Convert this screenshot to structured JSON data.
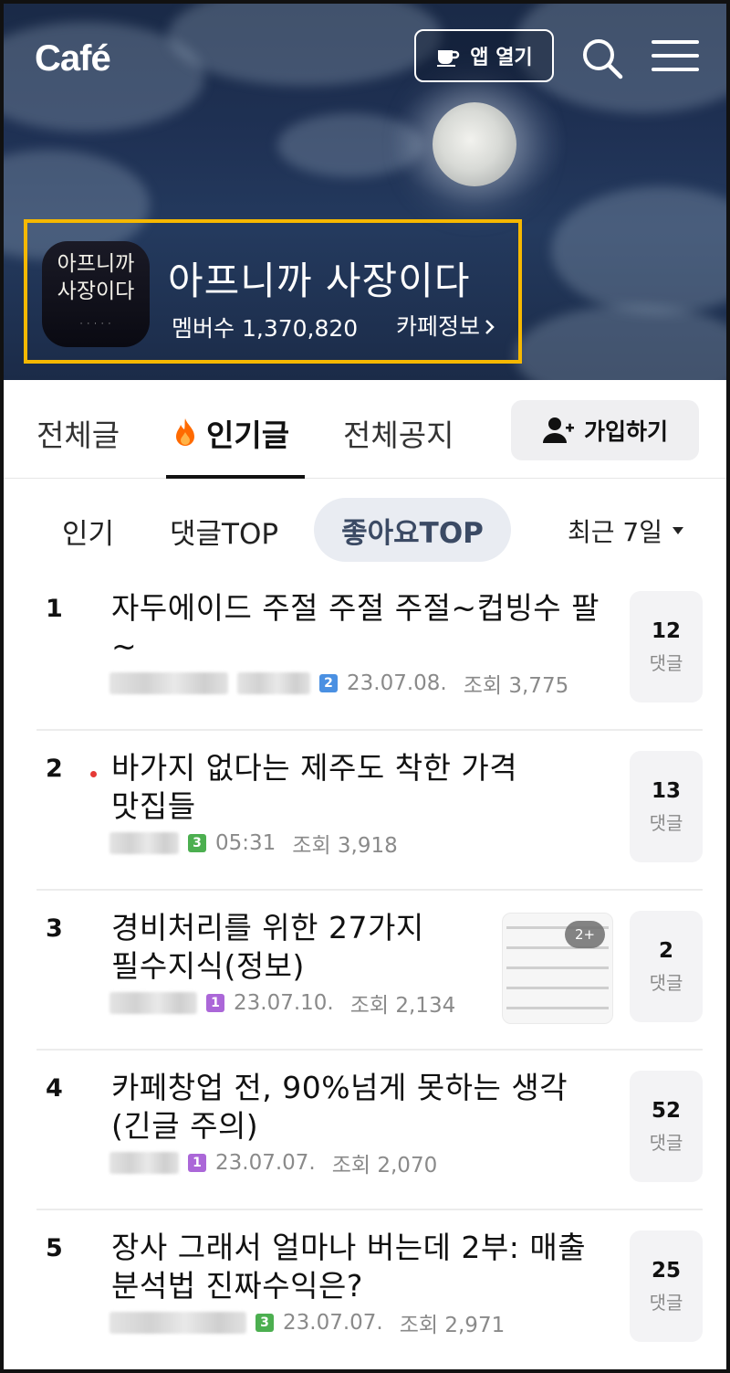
{
  "header": {
    "logo": "Café",
    "open_app_label": "앱 열기"
  },
  "cafe": {
    "name": "아프니까 사장이다",
    "members_label": "멤버수",
    "members_count": "1,370,820",
    "info_link": "카페정보",
    "thumb_line1": "아프니까",
    "thumb_line2": "사장이다"
  },
  "tabs": {
    "all": "전체글",
    "popular": "인기글",
    "notice": "전체공지",
    "join": "가입하기"
  },
  "filters": {
    "popular": "인기",
    "comment_top": "댓글TOP",
    "like_top": "좋아요TOP",
    "period": "최근 7일"
  },
  "posts": [
    {
      "rank": "1",
      "title": "자두에이드 주절 주절 주절~컵빙수 팔~",
      "level": "2",
      "level_color": "#4a90e2",
      "date": "23.07.08.",
      "views": "조회 3,775",
      "comments": "12",
      "comments_label": "댓글"
    },
    {
      "rank": "2",
      "title": "바가지 없다는 제주도 착한 가격 맛집들",
      "level": "3",
      "level_color": "#4caf50",
      "date": "05:31",
      "views": "조회 3,918",
      "comments": "13",
      "comments_label": "댓글"
    },
    {
      "rank": "3",
      "title": "경비처리를 위한 27가지 필수지식(정보)",
      "level": "1",
      "level_color": "#ab67d8",
      "date": "23.07.10.",
      "views": "조회 2,134",
      "comments": "2",
      "comments_label": "댓글",
      "thumb_badge": "2+"
    },
    {
      "rank": "4",
      "title": "카페창업 전, 90%넘게 못하는 생각(긴글 주의)",
      "level": "1",
      "level_color": "#ab67d8",
      "date": "23.07.07.",
      "views": "조회 2,070",
      "comments": "52",
      "comments_label": "댓글"
    },
    {
      "rank": "5",
      "title": "장사 그래서 얼마나 버는데 2부: 매출 분석법 진짜수익은?",
      "level": "3",
      "level_color": "#4caf50",
      "date": "23.07.07.",
      "views": "조회 2,971",
      "comments": "25",
      "comments_label": "댓글"
    }
  ],
  "colors": {
    "highlight_border": "#f6b800",
    "flame": "#ff6a00",
    "new_dot": "#e53935"
  }
}
